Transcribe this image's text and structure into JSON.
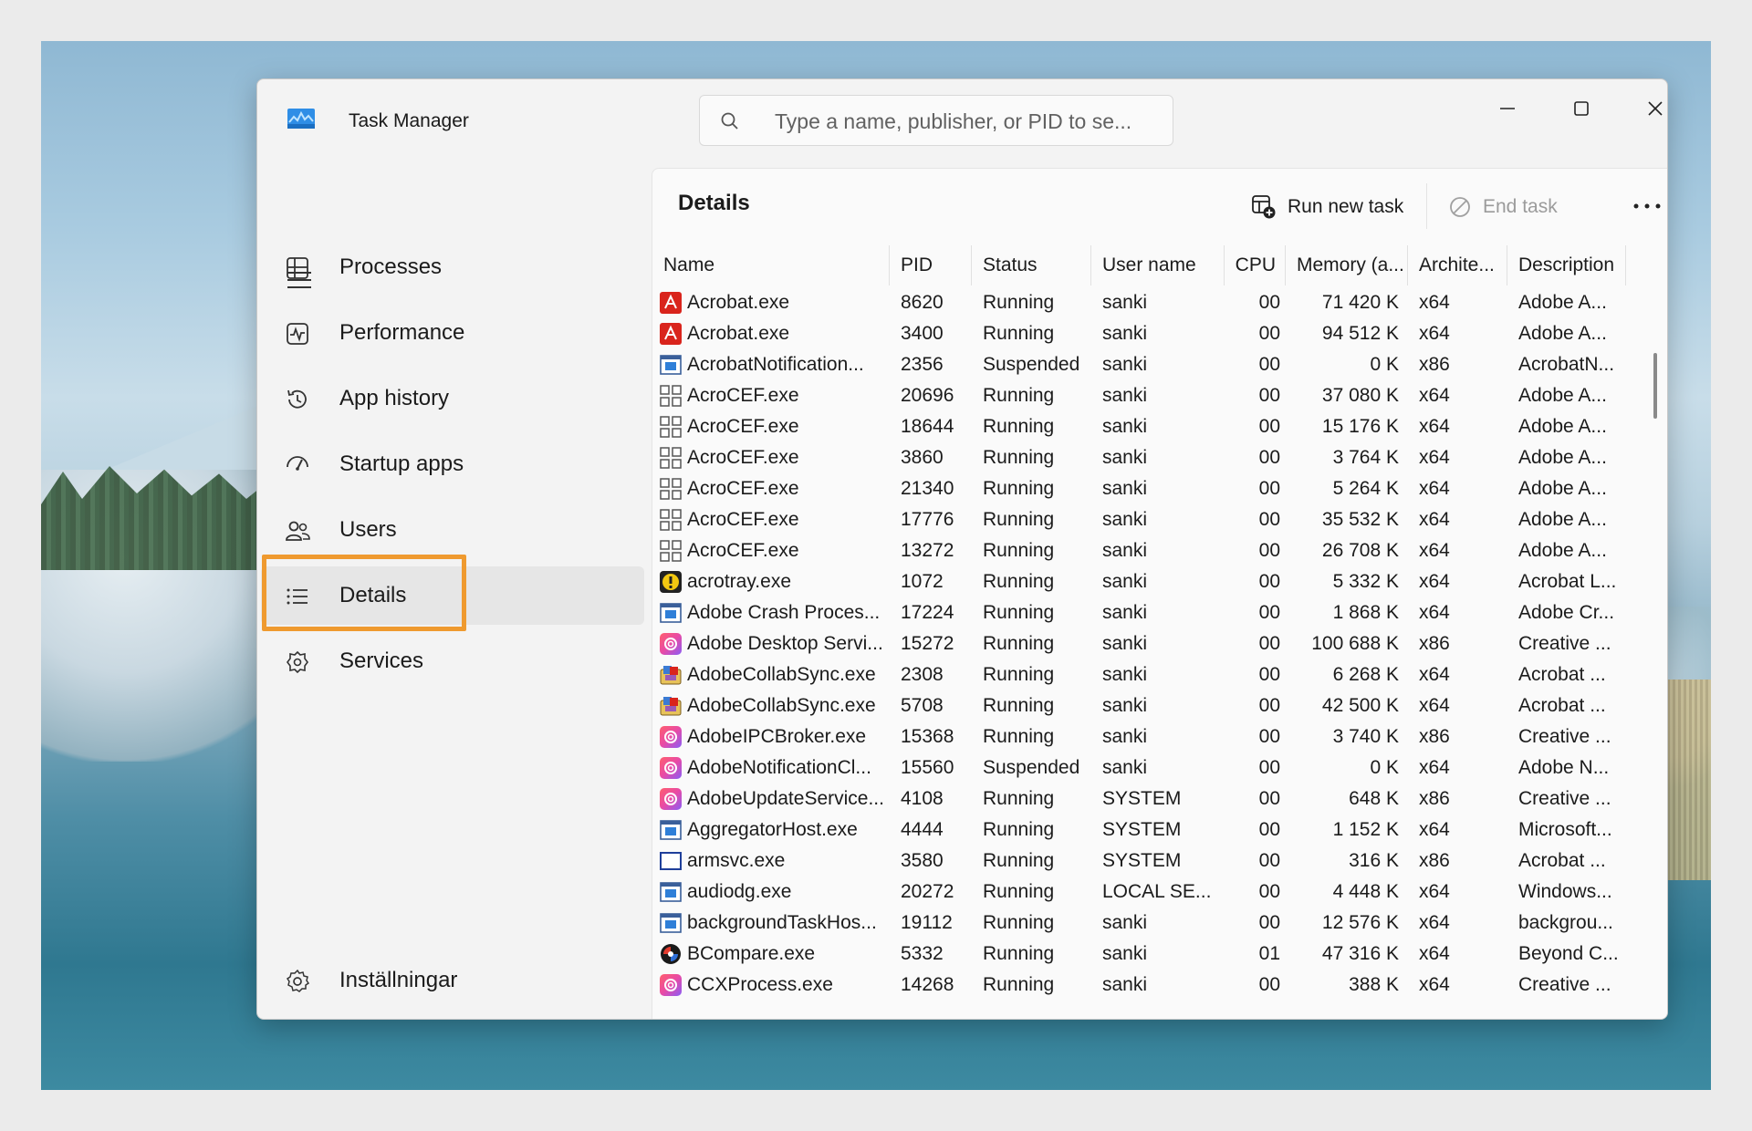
{
  "window": {
    "title": "Task Manager",
    "search_placeholder": "Type a name, publisher, or PID to se...",
    "controls": [
      "minimize",
      "maximize",
      "close"
    ]
  },
  "sidebar": {
    "items": [
      {
        "label": "Processes",
        "icon": "processes-icon"
      },
      {
        "label": "Performance",
        "icon": "performance-icon"
      },
      {
        "label": "App history",
        "icon": "app-history-icon"
      },
      {
        "label": "Startup apps",
        "icon": "startup-apps-icon"
      },
      {
        "label": "Users",
        "icon": "users-icon"
      },
      {
        "label": "Details",
        "icon": "details-icon",
        "active": true
      },
      {
        "label": "Services",
        "icon": "services-icon"
      }
    ],
    "settings_label": "Inställningar",
    "highlight_color": "#ef9a2f"
  },
  "panel": {
    "title": "Details",
    "run_new_task": "Run new task",
    "end_task": "End task"
  },
  "table": {
    "columns": [
      "Name",
      "PID",
      "Status",
      "User name",
      "CPU",
      "Memory (a...",
      "Archite...",
      "Description"
    ],
    "rows": [
      {
        "icon": "acrobat",
        "name": "Acrobat.exe",
        "pid": "8620",
        "status": "Running",
        "user": "sanki",
        "cpu": "00",
        "mem": "71 420 K",
        "arch": "x64",
        "desc": "Adobe A..."
      },
      {
        "icon": "acrobat",
        "name": "Acrobat.exe",
        "pid": "3400",
        "status": "Running",
        "user": "sanki",
        "cpu": "00",
        "mem": "94 512 K",
        "arch": "x64",
        "desc": "Adobe A..."
      },
      {
        "icon": "window",
        "name": "AcrobatNotification...",
        "pid": "2356",
        "status": "Suspended",
        "user": "sanki",
        "cpu": "00",
        "mem": "0 K",
        "arch": "x86",
        "desc": "AcrobatN..."
      },
      {
        "icon": "grid",
        "name": "AcroCEF.exe",
        "pid": "20696",
        "status": "Running",
        "user": "sanki",
        "cpu": "00",
        "mem": "37 080 K",
        "arch": "x64",
        "desc": "Adobe A..."
      },
      {
        "icon": "grid",
        "name": "AcroCEF.exe",
        "pid": "18644",
        "status": "Running",
        "user": "sanki",
        "cpu": "00",
        "mem": "15 176 K",
        "arch": "x64",
        "desc": "Adobe A..."
      },
      {
        "icon": "grid",
        "name": "AcroCEF.exe",
        "pid": "3860",
        "status": "Running",
        "user": "sanki",
        "cpu": "00",
        "mem": "3 764 K",
        "arch": "x64",
        "desc": "Adobe A..."
      },
      {
        "icon": "grid",
        "name": "AcroCEF.exe",
        "pid": "21340",
        "status": "Running",
        "user": "sanki",
        "cpu": "00",
        "mem": "5 264 K",
        "arch": "x64",
        "desc": "Adobe A..."
      },
      {
        "icon": "grid",
        "name": "AcroCEF.exe",
        "pid": "17776",
        "status": "Running",
        "user": "sanki",
        "cpu": "00",
        "mem": "35 532 K",
        "arch": "x64",
        "desc": "Adobe A..."
      },
      {
        "icon": "grid",
        "name": "AcroCEF.exe",
        "pid": "13272",
        "status": "Running",
        "user": "sanki",
        "cpu": "00",
        "mem": "26 708 K",
        "arch": "x64",
        "desc": "Adobe A..."
      },
      {
        "icon": "warning",
        "name": "acrotray.exe",
        "pid": "1072",
        "status": "Running",
        "user": "sanki",
        "cpu": "00",
        "mem": "5 332 K",
        "arch": "x64",
        "desc": "Acrobat L..."
      },
      {
        "icon": "window",
        "name": "Adobe Crash Proces...",
        "pid": "17224",
        "status": "Running",
        "user": "sanki",
        "cpu": "00",
        "mem": "1 868 K",
        "arch": "x64",
        "desc": "Adobe Cr..."
      },
      {
        "icon": "creative",
        "name": "Adobe Desktop Servi...",
        "pid": "15272",
        "status": "Running",
        "user": "sanki",
        "cpu": "00",
        "mem": "100 688 K",
        "arch": "x86",
        "desc": "Creative ..."
      },
      {
        "icon": "collab",
        "name": "AdobeCollabSync.exe",
        "pid": "2308",
        "status": "Running",
        "user": "sanki",
        "cpu": "00",
        "mem": "6 268 K",
        "arch": "x64",
        "desc": "Acrobat ..."
      },
      {
        "icon": "collab",
        "name": "AdobeCollabSync.exe",
        "pid": "5708",
        "status": "Running",
        "user": "sanki",
        "cpu": "00",
        "mem": "42 500 K",
        "arch": "x64",
        "desc": "Acrobat ..."
      },
      {
        "icon": "creative",
        "name": "AdobeIPCBroker.exe",
        "pid": "15368",
        "status": "Running",
        "user": "sanki",
        "cpu": "00",
        "mem": "3 740 K",
        "arch": "x86",
        "desc": "Creative ..."
      },
      {
        "icon": "creative",
        "name": "AdobeNotificationCl...",
        "pid": "15560",
        "status": "Suspended",
        "user": "sanki",
        "cpu": "00",
        "mem": "0 K",
        "arch": "x64",
        "desc": "Adobe N..."
      },
      {
        "icon": "creative",
        "name": "AdobeUpdateService...",
        "pid": "4108",
        "status": "Running",
        "user": "SYSTEM",
        "cpu": "00",
        "mem": "648 K",
        "arch": "x86",
        "desc": "Creative ..."
      },
      {
        "icon": "window",
        "name": "AggregatorHost.exe",
        "pid": "4444",
        "status": "Running",
        "user": "SYSTEM",
        "cpu": "00",
        "mem": "1 152 K",
        "arch": "x64",
        "desc": "Microsoft..."
      },
      {
        "icon": "blank-window",
        "name": "armsvc.exe",
        "pid": "3580",
        "status": "Running",
        "user": "SYSTEM",
        "cpu": "00",
        "mem": "316 K",
        "arch": "x86",
        "desc": "Acrobat ..."
      },
      {
        "icon": "window",
        "name": "audiodg.exe",
        "pid": "20272",
        "status": "Running",
        "user": "LOCAL SE...",
        "cpu": "00",
        "mem": "4 448 K",
        "arch": "x64",
        "desc": "Windows..."
      },
      {
        "icon": "window",
        "name": "backgroundTaskHos...",
        "pid": "19112",
        "status": "Running",
        "user": "sanki",
        "cpu": "00",
        "mem": "12 576 K",
        "arch": "x64",
        "desc": "backgrou..."
      },
      {
        "icon": "bcompare",
        "name": "BCompare.exe",
        "pid": "5332",
        "status": "Running",
        "user": "sanki",
        "cpu": "01",
        "mem": "47 316 K",
        "arch": "x64",
        "desc": "Beyond C..."
      },
      {
        "icon": "creative",
        "name": "CCXProcess.exe",
        "pid": "14268",
        "status": "Running",
        "user": "sanki",
        "cpu": "00",
        "mem": "388 K",
        "arch": "x64",
        "desc": "Creative ..."
      }
    ]
  }
}
